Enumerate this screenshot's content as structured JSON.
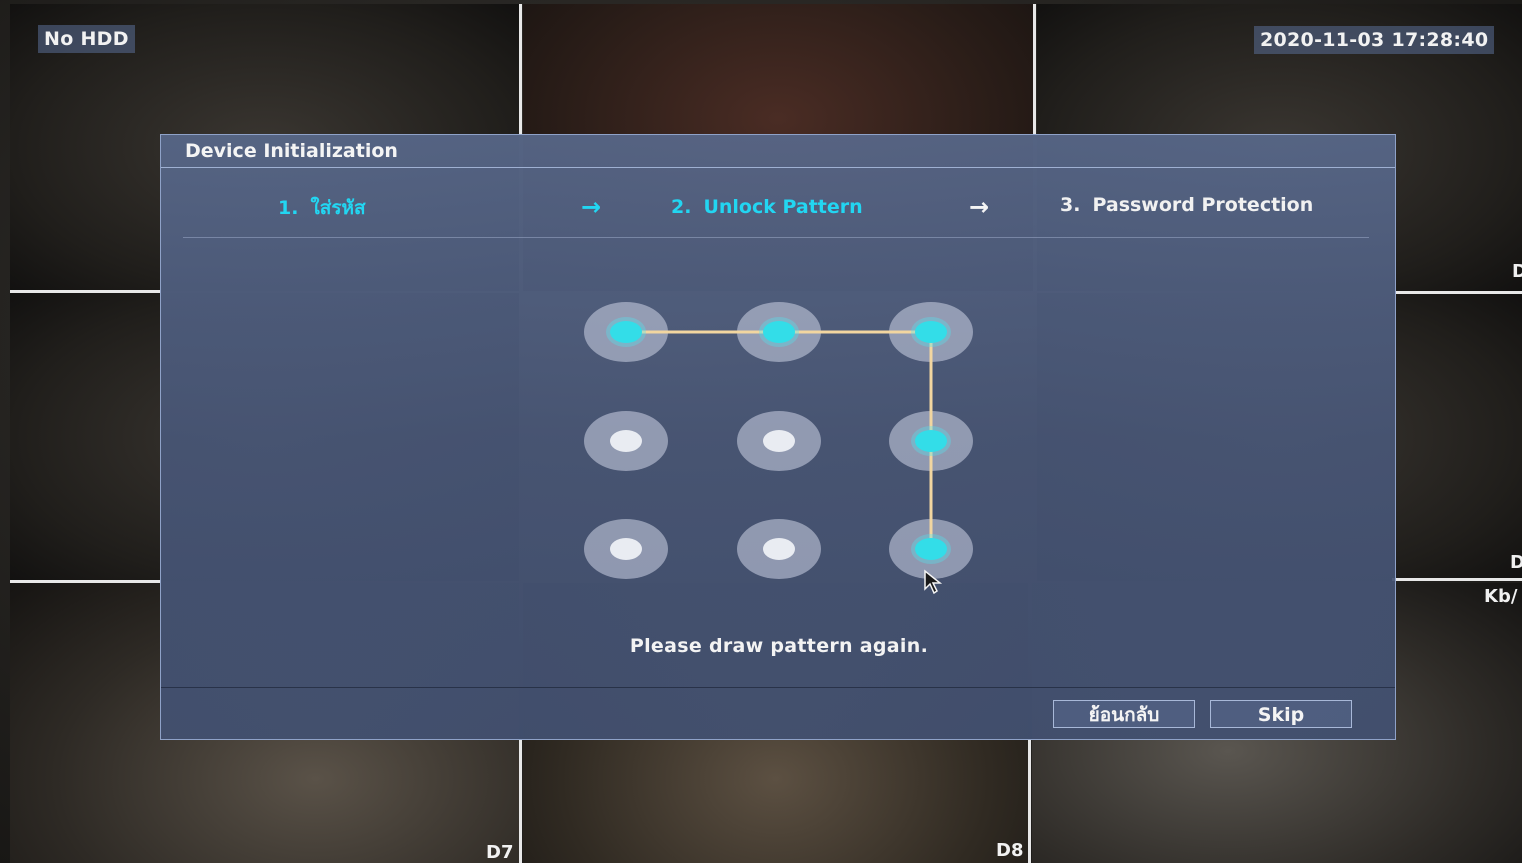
{
  "osd": {
    "hdd_status": "No HDD",
    "datetime": "2020-11-03 17:28:40",
    "channel_labels": [
      "D7",
      "D8"
    ],
    "right_edge_labels": [
      "D",
      "D",
      "Kb/"
    ]
  },
  "dialog": {
    "title": "Device Initialization",
    "steps": [
      {
        "number": "1.",
        "label": "ใส่รหัส",
        "state": "completed"
      },
      {
        "number": "2.",
        "label": "Unlock Pattern",
        "state": "current"
      },
      {
        "number": "3.",
        "label": "Password Protection",
        "state": "pending"
      }
    ],
    "step_arrow": "→",
    "pattern": {
      "grid": "3x3",
      "selected_dots": [
        1,
        2,
        3,
        6,
        9
      ],
      "path_order": [
        1,
        2,
        3,
        6,
        9
      ]
    },
    "prompt": "Please draw pattern again.",
    "buttons": {
      "back_label": "ย้อนกลับ",
      "skip_label": "Skip"
    }
  },
  "colors": {
    "accent": "#22d6f2",
    "path_line": "#f2d6a0",
    "dialog_bg": "#5a6a8c"
  }
}
